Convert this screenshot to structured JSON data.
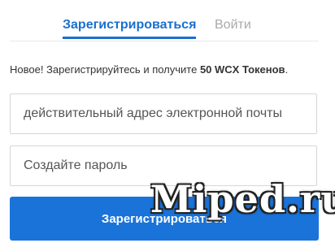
{
  "tabs": {
    "register_label": "Зарегистрироваться",
    "login_label": "Войти"
  },
  "promo": {
    "text_before": "Новое! Зарегистрируйтесь и получите ",
    "highlight": "50 WCX Токенов",
    "text_after": "."
  },
  "form": {
    "email_placeholder": "действительный адрес электронной почты",
    "password_placeholder": "Создайте пароль",
    "submit_label": "Зарегистрироваться"
  },
  "watermark": {
    "text": "Miped.ru"
  },
  "colors": {
    "accent": "#1a6fcf",
    "button": "#1a73d9"
  }
}
